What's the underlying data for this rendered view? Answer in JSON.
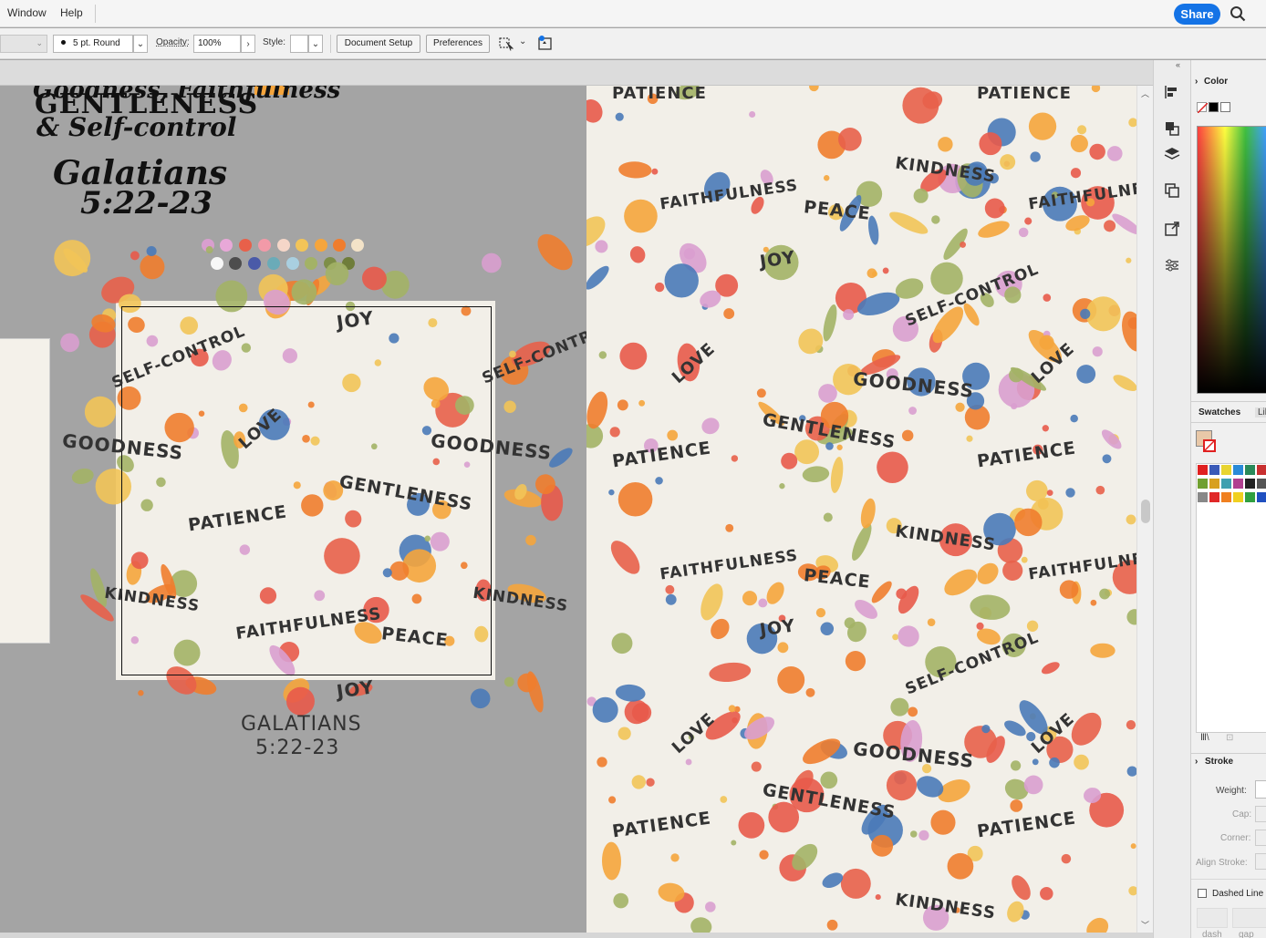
{
  "menu": {
    "items": [
      "Window",
      "Help"
    ],
    "share_label": "Share"
  },
  "controlbar": {
    "brush_value": "5 pt. Round",
    "opacity_label": "Opacity:",
    "opacity_value": "100%",
    "style_label": "Style:",
    "document_setup_label": "Document Setup",
    "preferences_label": "Preferences"
  },
  "artwork": {
    "title_lines": [
      "Goodness, Faithfulness",
      "GENTLENESS",
      "& Self-control"
    ],
    "verse_script": [
      "Galatians",
      "5:22-23"
    ],
    "bottom_verse": [
      "GALATIANS",
      "5:22-23"
    ],
    "words": [
      "JOY",
      "SELF-CONTROL",
      "GOODNESS",
      "LOVE",
      "GENTLENESS",
      "PATIENCE",
      "KINDNESS",
      "FAITHFULNESS",
      "PEACE"
    ],
    "palette_row1": [
      "#d99fcf",
      "#e8a8d8",
      "#e8604a",
      "#f29aa8",
      "#f5d6c8",
      "#f2c458",
      "#f5a53c",
      "#f07d2e",
      "#f3e3c8"
    ],
    "palette_row2": [
      "#f7f7f7",
      "#4d4d4d",
      "#4a5aa8",
      "#6aabb8",
      "#a9cfe0",
      "#a3b266",
      "#7e8e48",
      "#6f7d3a"
    ]
  },
  "preview": {
    "words": [
      "PATIENCE",
      "KINDNESS",
      "FAITHFULNESS",
      "PEACE",
      "JOY",
      "SELF-CONTROL",
      "LOVE",
      "GOODNESS",
      "GENTLENESS"
    ]
  },
  "panels": {
    "color_title": "Color",
    "swatches_tab": "Swatches",
    "libraries_tab": "Lib",
    "stroke_title": "Stroke",
    "weight_label": "Weight:",
    "cap_label": "Cap:",
    "corner_label": "Corner:",
    "align_stroke_label": "Align Stroke:",
    "dashed_line_label": "Dashed Line",
    "dash_label": "dash",
    "gap_label": "gap",
    "swatch_colors": [
      "#e02020",
      "#3a5ab8",
      "#e8d430",
      "#2a8ad8",
      "#2a8a5a",
      "#c83030",
      "#70a030",
      "#d8a020",
      "#40a0b0",
      "#b04090",
      "#222222",
      "#555555",
      "#888888",
      "#e02828",
      "#f08020",
      "#f0d020",
      "#30a040",
      "#2050c0"
    ]
  },
  "colors": {
    "accent": "#1473e6",
    "canvas": "#a4a4a4",
    "artboard": "#f2efe8"
  }
}
